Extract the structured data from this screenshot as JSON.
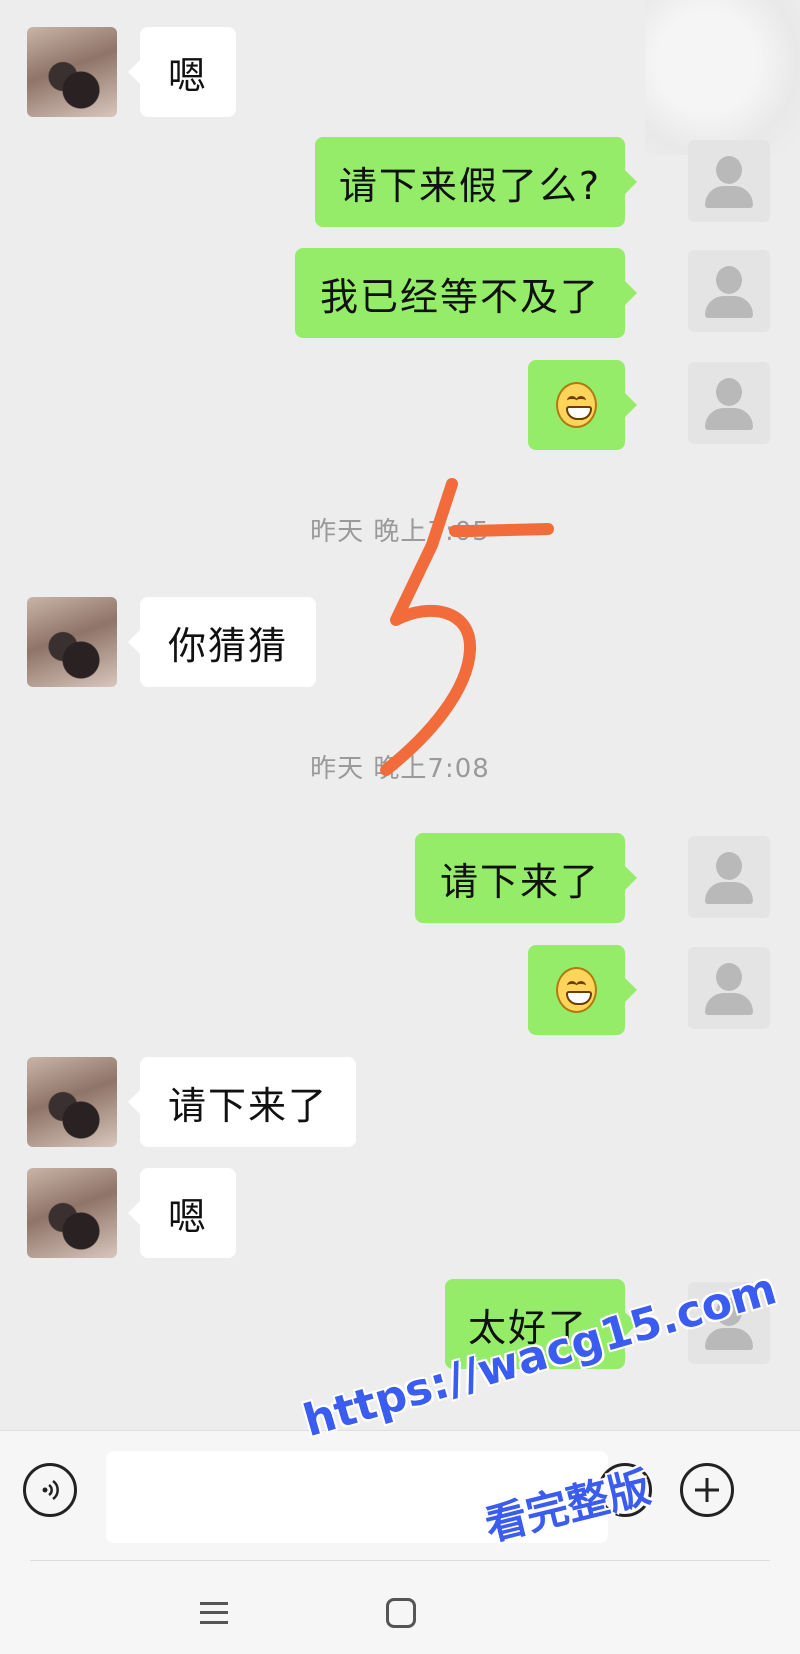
{
  "messages": [
    {
      "side": "left",
      "text": "嗯"
    },
    {
      "side": "right",
      "text": "请下来假了么?"
    },
    {
      "side": "right",
      "text": "我已经等不及了"
    },
    {
      "side": "right",
      "emoji": "grin-emoji"
    },
    {
      "time": "昨天 晚上7:05"
    },
    {
      "side": "left",
      "text": "你猜猜"
    },
    {
      "time": "昨天 晚上7:08"
    },
    {
      "side": "right",
      "text": "请下来了"
    },
    {
      "side": "right",
      "emoji": "grin-emoji"
    },
    {
      "side": "left",
      "text": "请下来了"
    },
    {
      "side": "left",
      "text": "嗯"
    },
    {
      "side": "right",
      "text": "太好了,"
    }
  ],
  "annotation": {
    "text": "5",
    "color": "#f26b3a"
  },
  "watermark": {
    "line1": "https://wacg15.com",
    "line2": "看完整版",
    "color": "#3a5cf0"
  },
  "colors": {
    "background": "#ededed",
    "bubble_self": "#95ec69",
    "bubble_other": "#ffffff",
    "time": "#9a9a9a"
  },
  "icons": {
    "voice": "voice-icon",
    "emoji": "emoji-icon",
    "plus": "plus-icon",
    "menu": "menu-icon",
    "home": "home-icon"
  }
}
